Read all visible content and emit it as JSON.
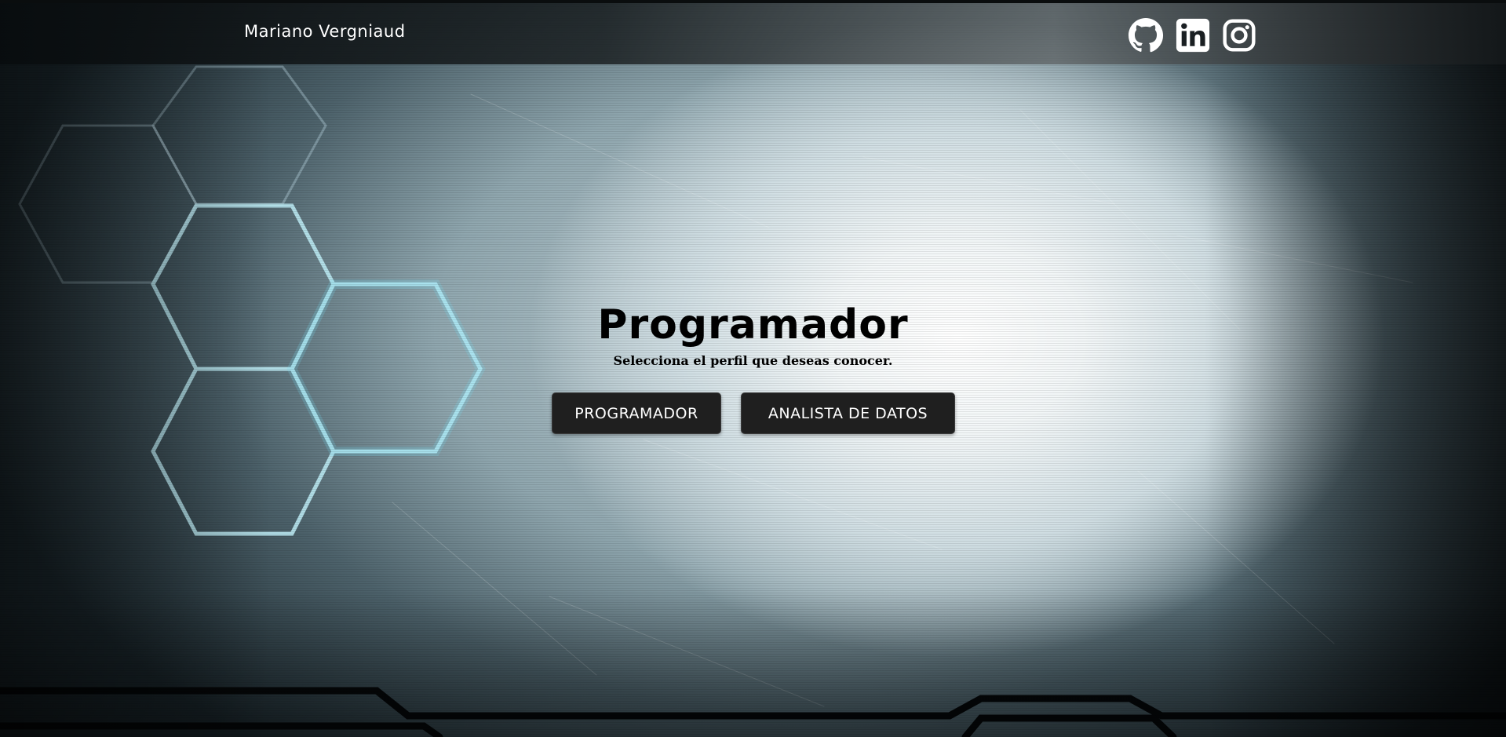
{
  "navbar": {
    "brand": "Mariano Vergniaud",
    "social": [
      {
        "icon": "github-icon"
      },
      {
        "icon": "linkedin-icon"
      },
      {
        "icon": "instagram-icon"
      }
    ]
  },
  "hero": {
    "title": "Programador",
    "subtitle": "Selecciona el perfil que deseas conocer.",
    "buttons": {
      "programmer_label": "PROGRAMADOR",
      "analyst_label": "ANALISTA DE DATOS"
    }
  },
  "colors": {
    "navbar_bg": "#0d1214",
    "button_bg": "#1f1f1f",
    "button_text": "#ffffff",
    "hex_glow": "#8fe0f0",
    "title_text": "#000000"
  }
}
